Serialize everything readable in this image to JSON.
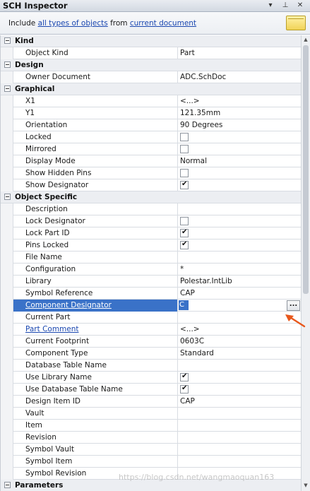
{
  "titlebar": {
    "title": "SCH Inspector",
    "menu_glyph": "▾",
    "pin_glyph": "⊥",
    "close_glyph": "✕"
  },
  "filter": {
    "prefix": "Include",
    "scope_link": "all types of objects",
    "middle": "from",
    "source_link": "current document"
  },
  "categories": {
    "kind": "Kind",
    "design": "Design",
    "graphical": "Graphical",
    "object_specific": "Object Specific",
    "parameters": "Parameters"
  },
  "kind": {
    "object_kind": {
      "label": "Object Kind",
      "value": "Part"
    }
  },
  "design": {
    "owner_document": {
      "label": "Owner Document",
      "value": "ADC.SchDoc"
    }
  },
  "graphical": {
    "x1": {
      "label": "X1",
      "value": "<...>"
    },
    "y1": {
      "label": "Y1",
      "value": "121.35mm"
    },
    "orientation": {
      "label": "Orientation",
      "value": "90 Degrees"
    },
    "locked": {
      "label": "Locked",
      "checked": false
    },
    "mirrored": {
      "label": "Mirrored",
      "checked": false
    },
    "display_mode": {
      "label": "Display Mode",
      "value": "Normal"
    },
    "show_hidden_pins": {
      "label": "Show Hidden Pins",
      "checked": false
    },
    "show_designator": {
      "label": "Show Designator",
      "checked": true
    }
  },
  "object_specific": {
    "description": {
      "label": "Description",
      "value": ""
    },
    "lock_designator": {
      "label": "Lock Designator",
      "checked": false
    },
    "lock_part_id": {
      "label": "Lock Part ID",
      "checked": true
    },
    "pins_locked": {
      "label": "Pins Locked",
      "checked": true
    },
    "file_name": {
      "label": "File Name",
      "value": ""
    },
    "configuration": {
      "label": "Configuration",
      "value": "*"
    },
    "library": {
      "label": "Library",
      "value": "Polestar.IntLib"
    },
    "symbol_reference": {
      "label": "Symbol Reference",
      "value": "CAP"
    },
    "component_designator": {
      "label": "Component Designator",
      "value": "C",
      "button": "..."
    },
    "current_part": {
      "label": "Current Part",
      "value": ""
    },
    "part_comment": {
      "label": "Part Comment",
      "value": "<...>"
    },
    "current_footprint": {
      "label": "Current Footprint",
      "value": "0603C"
    },
    "component_type": {
      "label": "Component Type",
      "value": "Standard"
    },
    "database_table_name": {
      "label": "Database Table Name",
      "value": ""
    },
    "use_library_name": {
      "label": "Use Library Name",
      "checked": true
    },
    "use_database_table_name": {
      "label": "Use Database Table Name",
      "checked": true
    },
    "design_item_id": {
      "label": "Design Item ID",
      "value": "CAP"
    },
    "vault": {
      "label": "Vault",
      "value": ""
    },
    "item": {
      "label": "Item",
      "value": ""
    },
    "revision": {
      "label": "Revision",
      "value": ""
    },
    "symbol_vault": {
      "label": "Symbol Vault",
      "value": ""
    },
    "symbol_item": {
      "label": "Symbol Item",
      "value": ""
    },
    "symbol_revision": {
      "label": "Symbol Revision",
      "value": ""
    }
  },
  "watermark": "https://blog.csdn.net/wangmaoquan163",
  "colors": {
    "selection": "#3a72c8",
    "link": "#1a47b0",
    "arrow": "#e8581c"
  }
}
